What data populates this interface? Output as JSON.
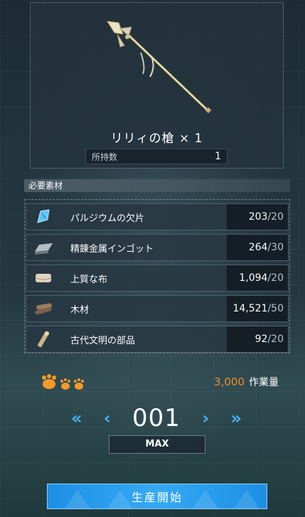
{
  "item": {
    "name": "リリィの槍 × 1",
    "owned_label": "所持数",
    "owned_value": "1",
    "icon": "spear-icon"
  },
  "materials": {
    "header": "必要素材",
    "items": [
      {
        "name": "パルジウムの欠片",
        "have": "203",
        "need": "/20",
        "icon": "crystal-shard-icon",
        "color": "#5ec8ff"
      },
      {
        "name": "精錬金属インゴット",
        "have": "264",
        "need": "/30",
        "icon": "metal-ingot-icon",
        "color": "#9aa3ab"
      },
      {
        "name": "上質な布",
        "have": "1,094",
        "need": "/20",
        "icon": "cloth-icon",
        "color": "#d8cbb8"
      },
      {
        "name": "木材",
        "have": "14,521",
        "need": "/50",
        "icon": "wood-icon",
        "color": "#8a6e52"
      },
      {
        "name": "古代文明の部品",
        "have": "92",
        "need": "/20",
        "icon": "ancient-part-icon",
        "color": "#c9b58a"
      }
    ]
  },
  "workload": {
    "value": "3,000",
    "label": "作業量",
    "icon": "paw-icon",
    "accent": "#f4892b"
  },
  "quantity": {
    "value": "001",
    "max_label": "MAX"
  },
  "start_button": {
    "label": "生産開始",
    "color": "#1d8fe6"
  }
}
